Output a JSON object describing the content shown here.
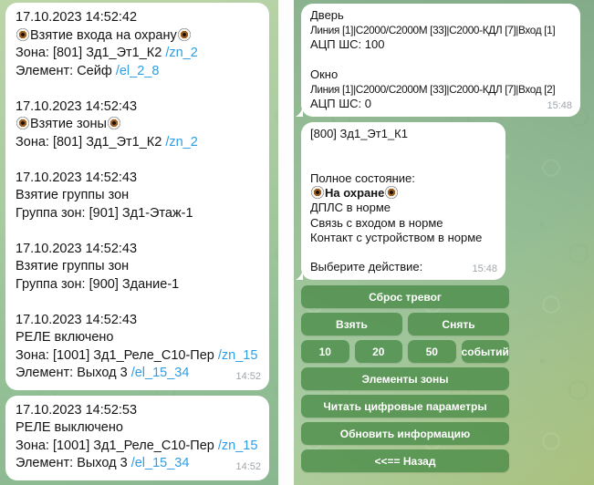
{
  "colors": {
    "link": "#2f9de3",
    "keyboard_button": "#4d8d4a",
    "bubble": "#ffffff",
    "timestamp": "#9fa6ab",
    "background_light": "#bcd5a8",
    "background_dark": "#84ab89",
    "background_olive": "#acbe73",
    "divider": "#fdfdfd"
  },
  "left_panel": {
    "messages": [
      {
        "time": "14:52",
        "lines": [
          {
            "segments": [
              {
                "type": "text",
                "value": "17.10.2023 14:52:42"
              }
            ]
          },
          {
            "segments": [
              {
                "type": "eye"
              },
              {
                "type": "text",
                "value": "Взятие входа на охрану"
              },
              {
                "type": "eye"
              }
            ]
          },
          {
            "segments": [
              {
                "type": "text",
                "value": "Зона: [801] Зд1_Эт1_К2 "
              },
              {
                "type": "link",
                "value": "/zn_2"
              }
            ]
          },
          {
            "segments": [
              {
                "type": "text",
                "value": "Элемент: Сейф "
              },
              {
                "type": "link",
                "value": "/el_2_8"
              }
            ]
          },
          {
            "segments": []
          },
          {
            "segments": [
              {
                "type": "text",
                "value": "17.10.2023 14:52:43"
              }
            ]
          },
          {
            "segments": [
              {
                "type": "eye"
              },
              {
                "type": "text",
                "value": "Взятие зоны"
              },
              {
                "type": "eye"
              }
            ]
          },
          {
            "segments": [
              {
                "type": "text",
                "value": "Зона: [801] Зд1_Эт1_К2 "
              },
              {
                "type": "link",
                "value": "/zn_2"
              }
            ]
          },
          {
            "segments": []
          },
          {
            "segments": [
              {
                "type": "text",
                "value": "17.10.2023 14:52:43"
              }
            ]
          },
          {
            "segments": [
              {
                "type": "text",
                "value": "Взятие группы зон"
              }
            ]
          },
          {
            "segments": [
              {
                "type": "text",
                "value": "Группа зон: [901] Зд1-Этаж-1"
              }
            ]
          },
          {
            "segments": []
          },
          {
            "segments": [
              {
                "type": "text",
                "value": "17.10.2023 14:52:43"
              }
            ]
          },
          {
            "segments": [
              {
                "type": "text",
                "value": "Взятие группы зон"
              }
            ]
          },
          {
            "segments": [
              {
                "type": "text",
                "value": "Группа зон: [900] Здание-1"
              }
            ]
          },
          {
            "segments": []
          },
          {
            "segments": [
              {
                "type": "text",
                "value": "17.10.2023 14:52:43"
              }
            ]
          },
          {
            "segments": [
              {
                "type": "text",
                "value": "РЕЛЕ включено"
              }
            ]
          },
          {
            "segments": [
              {
                "type": "text",
                "value": "Зона: [1001] Зд1_Реле_С10-Пер "
              },
              {
                "type": "link",
                "value": "/zn_15"
              }
            ]
          },
          {
            "segments": [
              {
                "type": "text",
                "value": "Элемент: Выход 3 "
              },
              {
                "type": "link",
                "value": "/el_15_34"
              }
            ]
          }
        ]
      },
      {
        "time": "14:52",
        "lines": [
          {
            "segments": [
              {
                "type": "text",
                "value": "17.10.2023 14:52:53"
              }
            ]
          },
          {
            "segments": [
              {
                "type": "text",
                "value": "РЕЛЕ выключено"
              }
            ]
          },
          {
            "segments": [
              {
                "type": "text",
                "value": "Зона: [1001] Зд1_Реле_С10-Пер "
              },
              {
                "type": "link",
                "value": "/zn_15"
              }
            ]
          },
          {
            "segments": [
              {
                "type": "text",
                "value": "Элемент: Выход 3 "
              },
              {
                "type": "link",
                "value": "/el_15_34"
              }
            ]
          }
        ]
      }
    ]
  },
  "right_panel": {
    "messages": [
      {
        "time": "15:48",
        "tail": true,
        "lines": [
          {
            "segments": [
              {
                "type": "text",
                "value": "Дверь"
              }
            ]
          },
          {
            "segments": [
              {
                "type": "text",
                "value": "Линия [1]|С2000/С2000М [33]|С2000-КДЛ [7]|Вход [1]"
              }
            ]
          },
          {
            "segments": [
              {
                "type": "text",
                "value": "АЦП ШС: 100"
              }
            ]
          },
          {
            "segments": []
          },
          {
            "segments": [
              {
                "type": "text",
                "value": "Окно"
              }
            ]
          },
          {
            "segments": [
              {
                "type": "text",
                "value": "Линия [1]|С2000/С2000М [33]|С2000-КДЛ [7]|Вход [2]"
              }
            ]
          },
          {
            "segments": [
              {
                "type": "text",
                "value": "АЦП ШС: 0"
              }
            ]
          }
        ]
      },
      {
        "time": "15:48",
        "tail": true,
        "lines": [
          {
            "segments": [
              {
                "type": "text",
                "value": "[800] Зд1_Эт1_К1"
              }
            ]
          },
          {
            "segments": []
          },
          {
            "segments": []
          },
          {
            "segments": [
              {
                "type": "text",
                "value": "Полное состояние:"
              }
            ]
          },
          {
            "segments": [
              {
                "type": "eye"
              },
              {
                "type": "bold",
                "value": "На охране"
              },
              {
                "type": "eye"
              }
            ]
          },
          {
            "segments": [
              {
                "type": "text",
                "value": "ДПЛС в норме"
              }
            ]
          },
          {
            "segments": [
              {
                "type": "text",
                "value": "Связь с входом в норме"
              }
            ]
          },
          {
            "segments": [
              {
                "type": "text",
                "value": "Контакт с устройством в норме"
              }
            ]
          },
          {
            "segments": []
          },
          {
            "segments": [
              {
                "type": "text",
                "value": "Выберите действие:"
              }
            ]
          }
        ]
      }
    ],
    "keyboard": {
      "rows": [
        {
          "buttons": [
            {
              "name": "reset-alarms-button",
              "label": "Сброс тревог"
            }
          ]
        },
        {
          "buttons": [
            {
              "name": "arm-button",
              "label": "Взять"
            },
            {
              "name": "disarm-button",
              "label": "Снять"
            }
          ]
        },
        {
          "buttons": [
            {
              "name": "events-10-button",
              "label": "10"
            },
            {
              "name": "events-20-button",
              "label": "20"
            },
            {
              "name": "events-50-button",
              "label": "50"
            },
            {
              "name": "events-label-button",
              "label": "событий"
            }
          ]
        },
        {
          "buttons": [
            {
              "name": "zone-elements-button",
              "label": "Элементы зоны"
            }
          ]
        },
        {
          "buttons": [
            {
              "name": "read-digital-params-button",
              "label": "Читать цифровые параметры"
            }
          ]
        },
        {
          "buttons": [
            {
              "name": "refresh-info-button",
              "label": "Обновить информацию"
            }
          ]
        },
        {
          "buttons": [
            {
              "name": "back-button",
              "label": "<<== Назад"
            }
          ]
        }
      ]
    }
  }
}
